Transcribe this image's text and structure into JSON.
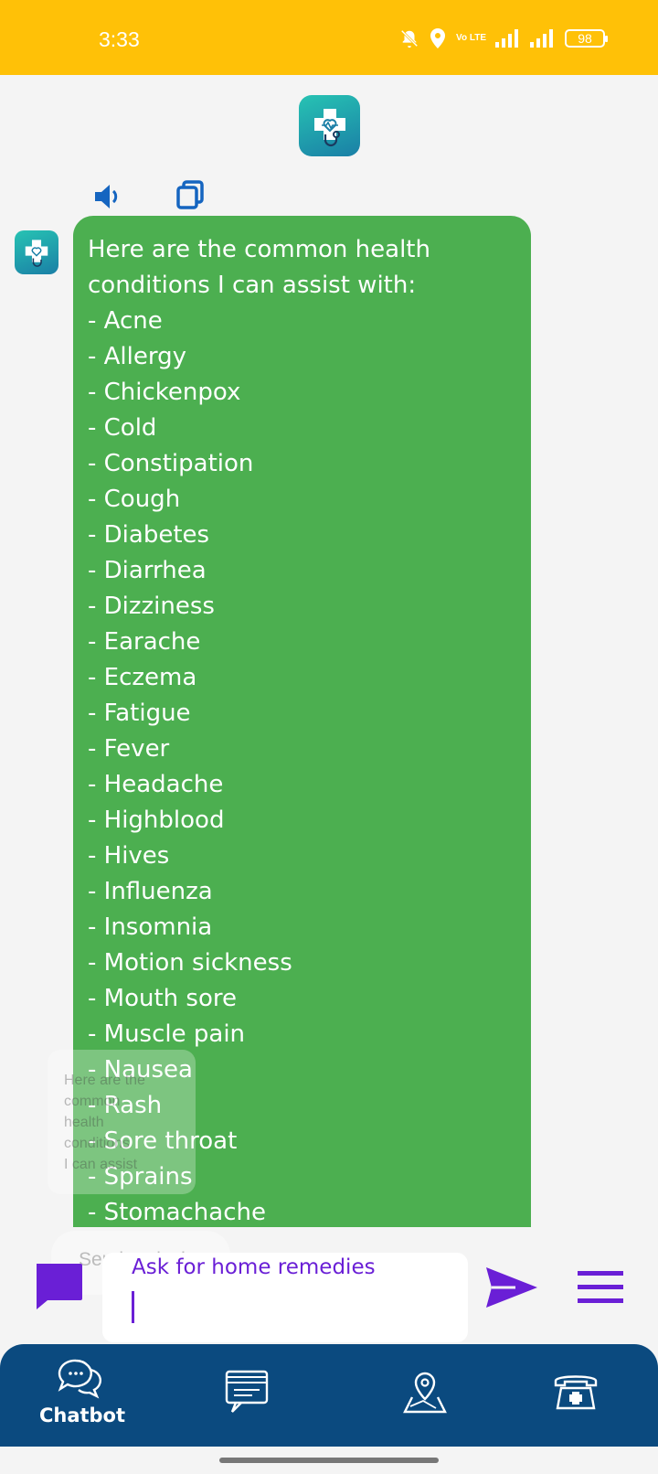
{
  "status_bar": {
    "time": "3:33",
    "network": "Vo LTE",
    "battery": "98"
  },
  "chat": {
    "message": "Here are the common health conditions I can assist with:\n- Acne\n- Allergy\n- Chickenpox\n- Cold\n- Constipation\n- Cough\n- Diabetes\n- Diarrhea\n- Dizziness\n- Earache\n- Eczema\n- Fatigue\n- Fever\n- Headache\n- Highblood\n- Hives\n- Influenza\n- Insomnia\n- Motion sickness\n- Mouth sore\n- Muscle pain\n- Nausea\n- Rash\n- Sore throat\n- Sprains\n- Stomachache",
    "ghost_preview": "Here are the\ncommon\nhealth\nconditions\nI can assist",
    "ghost_pill": "Send to device"
  },
  "input": {
    "placeholder": "Ask for home remedies"
  },
  "nav": {
    "chatbot_label": "Chatbot"
  },
  "colors": {
    "status_bar": "#ffc107",
    "bubble": "#4caf50",
    "accent": "#6a1fd6",
    "nav_bg": "#0b4a7f"
  }
}
